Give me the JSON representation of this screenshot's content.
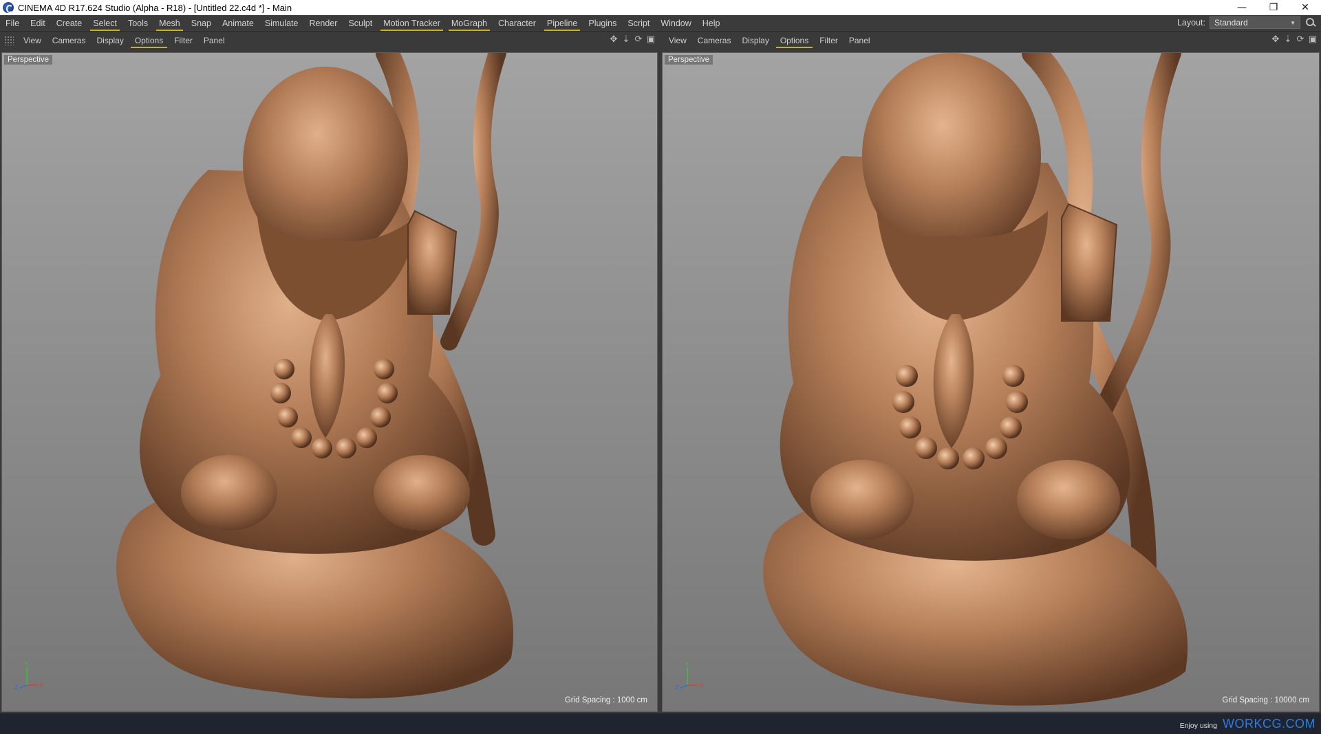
{
  "window": {
    "title": "CINEMA 4D R17.624 Studio (Alpha - R18) - [Untitled 22.c4d *] - Main",
    "controls": [
      "—",
      "❐",
      "✕"
    ]
  },
  "menubar": {
    "items": [
      {
        "label": "File",
        "hl": false
      },
      {
        "label": "Edit",
        "hl": false
      },
      {
        "label": "Create",
        "hl": false
      },
      {
        "label": "Select",
        "hl": true
      },
      {
        "label": "Tools",
        "hl": false
      },
      {
        "label": "Mesh",
        "hl": true
      },
      {
        "label": "Snap",
        "hl": false
      },
      {
        "label": "Animate",
        "hl": false
      },
      {
        "label": "Simulate",
        "hl": false
      },
      {
        "label": "Render",
        "hl": false
      },
      {
        "label": "Sculpt",
        "hl": false
      },
      {
        "label": "Motion Tracker",
        "hl": true
      },
      {
        "label": "MoGraph",
        "hl": true
      },
      {
        "label": "Character",
        "hl": false
      },
      {
        "label": "Pipeline",
        "hl": true
      },
      {
        "label": "Plugins",
        "hl": false
      },
      {
        "label": "Script",
        "hl": false
      },
      {
        "label": "Window",
        "hl": false
      },
      {
        "label": "Help",
        "hl": false
      }
    ],
    "layout_label": "Layout:",
    "layout_value": "Standard",
    "search_icon": "search-icon"
  },
  "viewports": [
    {
      "menu": [
        "View",
        "Cameras",
        "Display",
        "Options",
        "Filter",
        "Panel"
      ],
      "active_menu": "Options",
      "camera_label": "Perspective",
      "grid_spacing": "Grid Spacing : 1000 cm",
      "axis": {
        "y": "Y",
        "z": "Z",
        "x": "X"
      }
    },
    {
      "menu": [
        "View",
        "Cameras",
        "Display",
        "Options",
        "Filter",
        "Panel"
      ],
      "active_menu": "Options",
      "camera_label": "Perspective",
      "grid_spacing": "Grid Spacing : 10000 cm",
      "axis": {
        "y": "Y",
        "z": "Z",
        "x": "X"
      }
    }
  ],
  "nav_icons": [
    "move-view-icon",
    "zoom-view-icon",
    "rotate-view-icon",
    "maximize-view-icon"
  ],
  "watermark": {
    "small": "Enjoy using",
    "big": "WORKCG.COM"
  },
  "colors": {
    "accent": "#c8b41a",
    "statue": "#b07a55",
    "watermark": "#2a7fe0"
  }
}
